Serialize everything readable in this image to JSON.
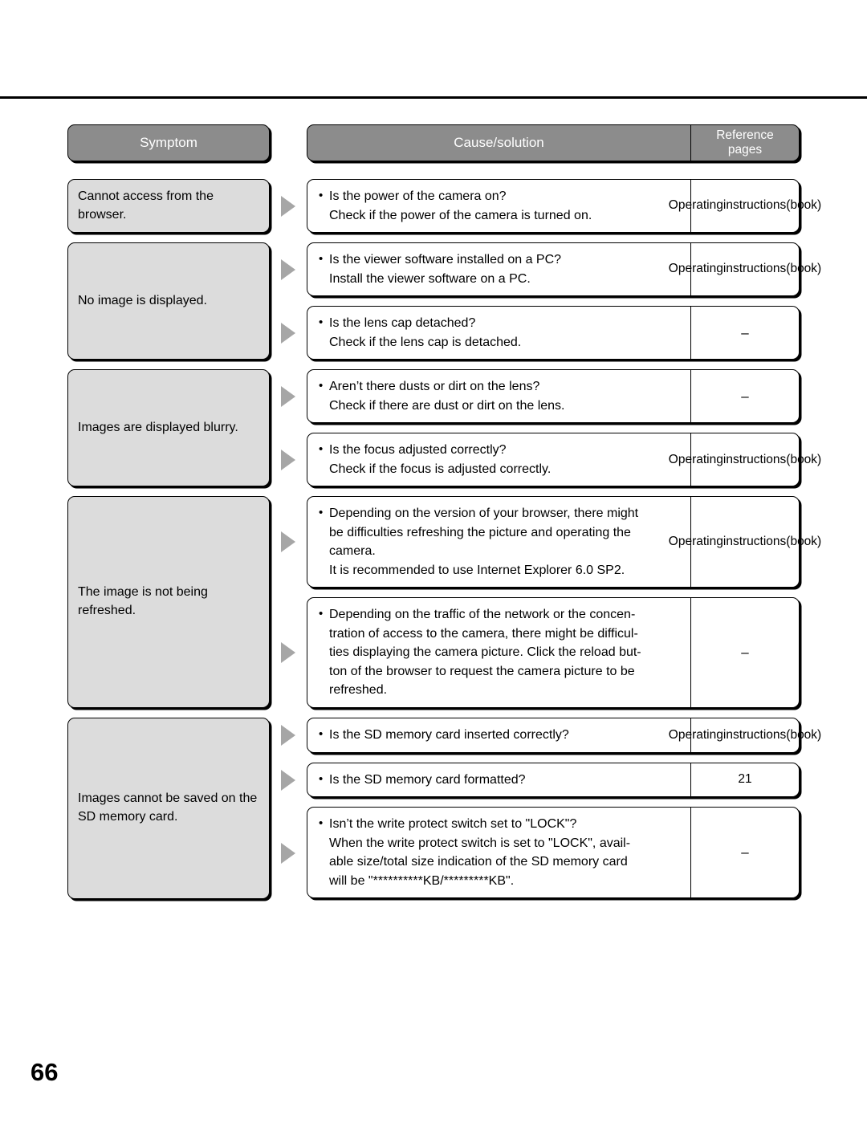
{
  "page": {
    "number": "66"
  },
  "header": {
    "symptom_label": "Symptom",
    "cause_label": "Cause/solution",
    "reference_label_line1": "Reference",
    "reference_label_line2": "pages"
  },
  "icons": {
    "arrow": "triangle-right-icon"
  },
  "reference_values": {
    "operating_line1": "Operating",
    "operating_line2": "instructions",
    "operating_line3": "(book)",
    "dash": "–",
    "page_21": "21"
  },
  "groups": [
    {
      "symptom": "Cannot access from the browser.",
      "rows": [
        {
          "lines": [
            "Is the power of the camera on?",
            "Check if the power of the camera is turned on."
          ],
          "reference_type": "operating"
        }
      ]
    },
    {
      "symptom": "No image is displayed.",
      "rows": [
        {
          "lines": [
            "Is the viewer software installed on a PC?",
            "Install the viewer software on a PC."
          ],
          "reference_type": "operating"
        },
        {
          "lines": [
            "Is the lens cap detached?",
            "Check if the lens cap is detached."
          ],
          "reference_type": "dash"
        }
      ]
    },
    {
      "symptom": "Images are displayed blurry.",
      "rows": [
        {
          "lines": [
            "Aren’t there dusts or dirt on the lens?",
            "Check if there are dust or dirt on the lens."
          ],
          "reference_type": "dash"
        },
        {
          "lines": [
            "Is the focus adjusted correctly?",
            "Check if the focus is adjusted correctly."
          ],
          "reference_type": "operating"
        }
      ]
    },
    {
      "symptom": "The image is not being refreshed.",
      "rows": [
        {
          "lines": [
            "Depending on the version of your browser, there might",
            "be difficulties refreshing the picture and operating the",
            "camera.",
            "It is recommended to use Internet Explorer 6.0 SP2."
          ],
          "reference_type": "operating"
        },
        {
          "lines": [
            "Depending on the traffic of the network or the concen-",
            "tration of access to the camera, there might be difficul-",
            "ties displaying the camera picture. Click the reload but-",
            "ton of the browser to request the camera picture to be",
            "refreshed."
          ],
          "reference_type": "dash"
        }
      ]
    },
    {
      "symptom": "Images cannot be saved on the SD memory card.",
      "rows": [
        {
          "lines": [
            "Is the SD memory card inserted correctly?"
          ],
          "reference_type": "operating"
        },
        {
          "lines": [
            "Is the SD memory card formatted?"
          ],
          "reference_type": "page_21"
        },
        {
          "lines": [
            "Isn’t the write protect switch set to \"LOCK\"?",
            "When the write protect switch is set to \"LOCK\", avail-",
            "able size/total size indication of the SD memory card",
            "will be \"**********KB/*********KB\"."
          ],
          "reference_type": "dash"
        }
      ]
    }
  ]
}
